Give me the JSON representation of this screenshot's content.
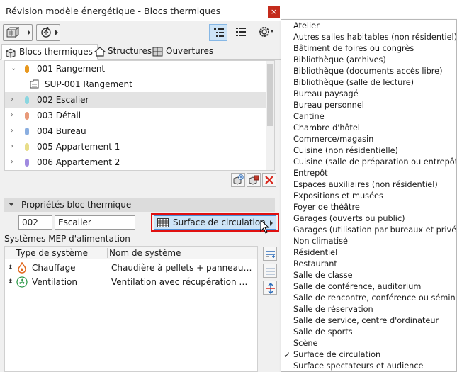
{
  "window": {
    "title": "Révision modèle énergétique - Blocs thermiques",
    "close_label": "×"
  },
  "tabs": [
    {
      "label": "Blocs thermiques",
      "icon": "blocks-icon",
      "active": true
    },
    {
      "label": "Structures",
      "icon": "house-icon",
      "active": false
    },
    {
      "label": "Ouvertures",
      "icon": "window-icon",
      "active": false
    }
  ],
  "tree": {
    "items": [
      {
        "label": "001 Rangement",
        "color": "#e8981f",
        "level": 0,
        "expanded": true
      },
      {
        "label": "SUP-001 Rangement",
        "icon": "zone-icon",
        "level": 1
      },
      {
        "label": "002 Escalier",
        "color": "#8ad6e0",
        "level": 0,
        "selected": true
      },
      {
        "label": "003 Détail",
        "color": "#e89a7a",
        "level": 0
      },
      {
        "label": "004 Bureau",
        "color": "#8aaee0",
        "level": 0
      },
      {
        "label": "005 Appartement 1",
        "color": "#e8dd8a",
        "level": 0
      },
      {
        "label": "006 Appartement 2",
        "color": "#a08ae0",
        "level": 0
      }
    ]
  },
  "properties": {
    "header": "Propriétés bloc thermique",
    "id_value": "002",
    "name_value": "Escalier",
    "profile_value": "Surface de circulation"
  },
  "mep": {
    "label": "Systèmes MEP d'alimentation",
    "columns": [
      "Type de système",
      "Nom de système"
    ],
    "rows": [
      {
        "type": "Chauffage",
        "icon": "flame-icon",
        "name": "Chaudière à pellets + panneaux sol..."
      },
      {
        "type": "Ventilation",
        "icon": "fan-icon",
        "name": "Ventilation avec récupération de ch..."
      }
    ]
  },
  "menu": {
    "items": [
      "Atelier",
      "Autres salles habitables (non résidentiel)",
      "Bâtiment de foires ou congrès",
      "Bibliothèque (archives)",
      "Bibliothèque (documents accès libre)",
      "Bibliothèque (salle de lecture)",
      "Bureau paysagé",
      "Bureau personnel",
      "Cantine",
      "Chambre d'hôtel",
      "Commerce/magasin",
      "Cuisine (non résidentielle)",
      "Cuisine (salle de préparation ou entrepôt)",
      "Entrepôt",
      "Espaces auxiliaires (non résidentiel)",
      "Expositions et musées",
      "Foyer de théâtre",
      "Garages (ouverts ou public)",
      "Garages (utilisation par bureaux et privée)",
      "Non climatisé",
      "Résidentiel",
      "Restaurant",
      "Salle de classe",
      "Salle de conférence, auditorium",
      "Salle de rencontre, conférence ou séminaire",
      "Salle de réservation",
      "Salle de service, centre d'ordinateur",
      "Salle de sports",
      "Scène",
      "Surface de circulation",
      "Surface spectateurs et audience"
    ],
    "checked": "Surface de circulation",
    "check_glyph": "✓"
  }
}
